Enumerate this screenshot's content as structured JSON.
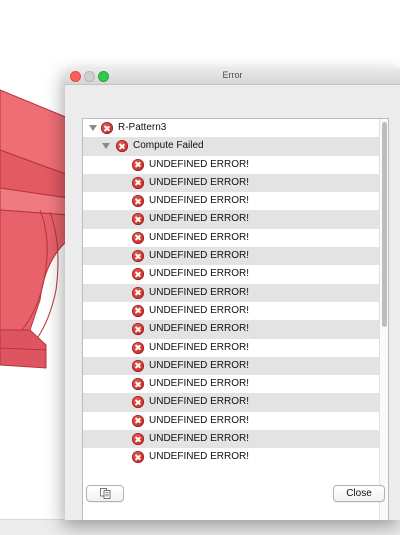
{
  "window": {
    "title": "Error"
  },
  "tree": {
    "root": {
      "label": "R-Pattern3",
      "icon": "error-icon",
      "expanded": true
    },
    "group": {
      "label": "Compute Failed",
      "icon": "error-icon",
      "expanded": true
    },
    "items": [
      {
        "label": "UNDEFINED ERROR!"
      },
      {
        "label": "UNDEFINED ERROR!"
      },
      {
        "label": "UNDEFINED ERROR!"
      },
      {
        "label": "UNDEFINED ERROR!"
      },
      {
        "label": "UNDEFINED ERROR!"
      },
      {
        "label": "UNDEFINED ERROR!"
      },
      {
        "label": "UNDEFINED ERROR!"
      },
      {
        "label": "UNDEFINED ERROR!"
      },
      {
        "label": "UNDEFINED ERROR!"
      },
      {
        "label": "UNDEFINED ERROR!"
      },
      {
        "label": "UNDEFINED ERROR!"
      },
      {
        "label": "UNDEFINED ERROR!"
      },
      {
        "label": "UNDEFINED ERROR!"
      },
      {
        "label": "UNDEFINED ERROR!"
      },
      {
        "label": "UNDEFINED ERROR!"
      },
      {
        "label": "UNDEFINED ERROR!"
      },
      {
        "label": "UNDEFINED ERROR!"
      }
    ]
  },
  "buttons": {
    "copy_icon": "copy-icon",
    "close_label": "Close"
  },
  "colors": {
    "model_fill": "#e8606a",
    "model_edge": "#b8333c",
    "error_red": "#c8231e"
  }
}
